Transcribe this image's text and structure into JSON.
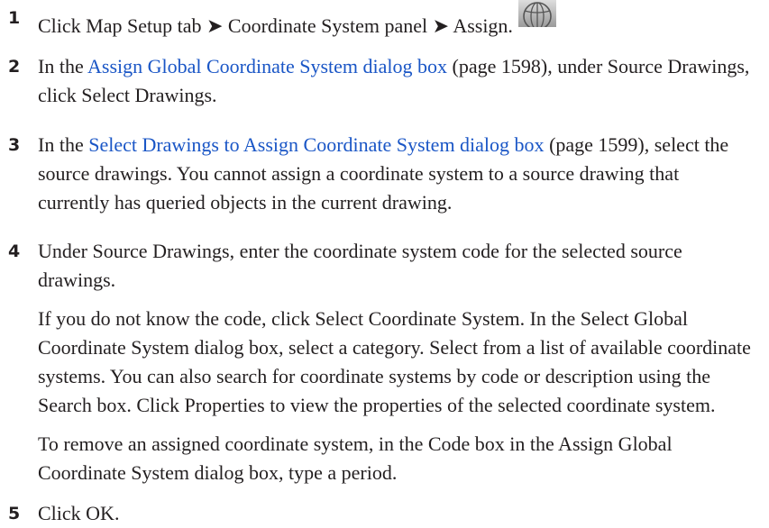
{
  "steps": [
    {
      "number": "1",
      "text_a": "Click Map Setup tab ➤ Coordinate System panel ➤ Assign.",
      "icon": "globe-icon"
    },
    {
      "number": "2",
      "pre": "In the ",
      "link": "Assign Global Coordinate System dialog box",
      "post": " (page 1598), under Source Drawings, click Select Drawings."
    },
    {
      "number": "3",
      "pre": "In the ",
      "link": "Select Drawings to Assign Coordinate System dialog box",
      "post": " (page 1599), select the source drawings. You cannot assign a coordinate system to a source drawing that currently has queried objects in the current drawing."
    },
    {
      "number": "4",
      "para1": "Under Source Drawings, enter the coordinate system code for the selected source drawings.",
      "para2": "If you do not know the code, click Select Coordinate System. In the Select Global Coordinate System dialog box, select a category. Select from a list of available coordinate systems. You can also search for coordinate systems by code or description using the Search box. Click Properties to view the properties of the selected coordinate system.",
      "para3": "To remove an assigned coordinate system, in the Code box in the Assign Global Coordinate System dialog box, type a period."
    },
    {
      "number": "5",
      "text": "Click OK."
    }
  ],
  "colors": {
    "link": "#1a56c6",
    "text": "#231f20"
  }
}
